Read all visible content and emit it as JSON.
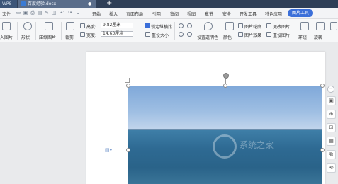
{
  "titlebar": {
    "app_tab": "WPS",
    "doc_tab": "百度经验.docx",
    "add_tab": "+"
  },
  "menubar": {
    "file": "文件",
    "items": [
      "开始",
      "插入",
      "页面布局",
      "引用",
      "审阅",
      "视图",
      "章节",
      "安全",
      "开发工具",
      "特色应用"
    ],
    "active": "图片工具"
  },
  "ribbon": {
    "insert_picture": "入图片",
    "shape": "形状",
    "compress": "压缩图片",
    "crop": "裁剪",
    "height_label": "高度:",
    "height_value": "9.82厘米",
    "width_label": "宽度:",
    "width_value": "14.63厘米",
    "lock_ratio": "锁定纵横比",
    "reset_size": "重设大小",
    "set_transparent": "设置透明色",
    "color": "颜色",
    "picture_outline": "图片轮廓",
    "change_picture": "更改图片",
    "picture_effect": "图片效果",
    "reset_picture": "重设图片",
    "wrap": "环绕",
    "rotate": "旋转"
  },
  "watermark": {
    "text": "系统之家"
  },
  "float_toolbar": {
    "minimize": "−"
  },
  "colors": {
    "title_bg": "#2f3f57",
    "accent": "#3b6fd9",
    "sky": "#8fb4de",
    "sea": "#2e6a93"
  }
}
